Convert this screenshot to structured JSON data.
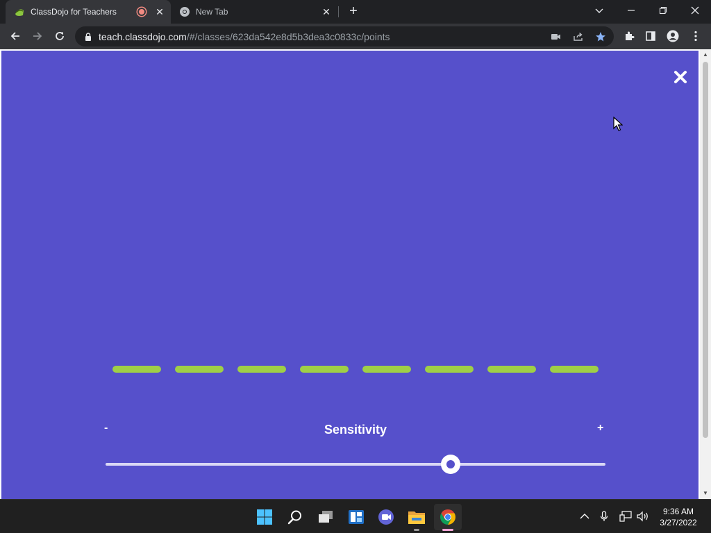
{
  "browser": {
    "tabs": [
      {
        "title": "ClassDojo for Teachers",
        "active": true,
        "recording": true
      },
      {
        "title": "New Tab",
        "active": false
      }
    ],
    "url": {
      "host": "teach.classdojo.com",
      "path": "/#/classes/623da542e8d5b3dea3c0833c/points"
    },
    "bookmarked": true
  },
  "page": {
    "background_color": "#5650cb",
    "meter": {
      "segment_count": 8,
      "active_segments": 8,
      "color": "#9fcf47"
    },
    "sensitivity": {
      "label": "Sensitivity",
      "minus_label": "-",
      "plus_label": "+",
      "value": 0.69
    }
  },
  "taskbar": {
    "apps": [
      "start-icon",
      "search-icon",
      "task-view-icon",
      "widgets-icon",
      "teams-chat-icon",
      "file-explorer-icon",
      "chrome-icon"
    ],
    "clock": {
      "time": "9:36 AM",
      "date": "3/27/2022"
    }
  }
}
